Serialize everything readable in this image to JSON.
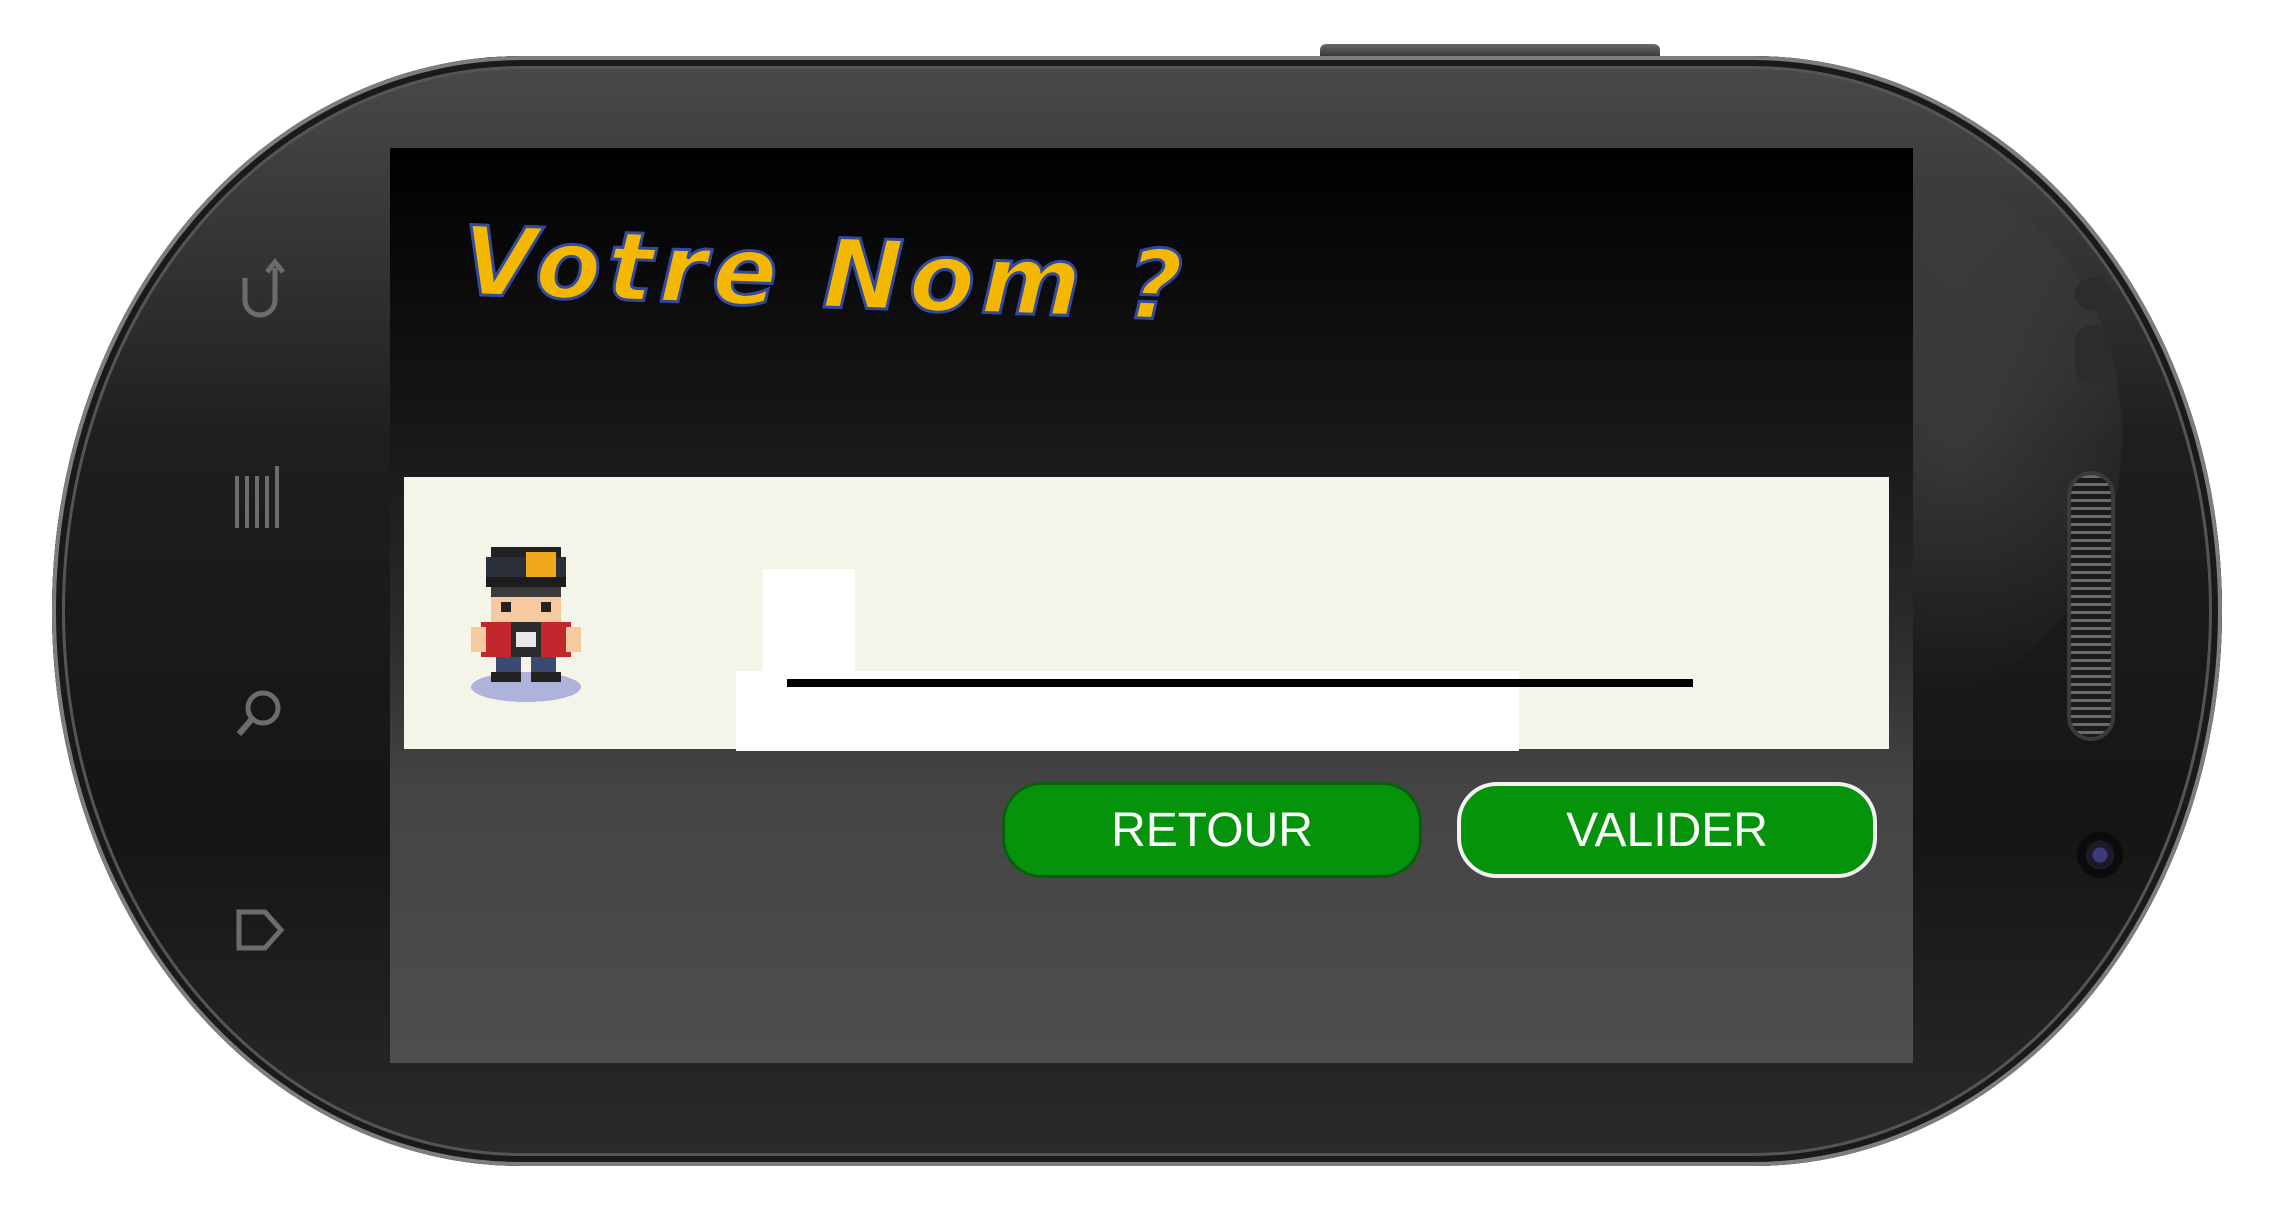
{
  "device": {
    "nav_keys": [
      "back-icon",
      "menu-icon",
      "search-icon",
      "home-icon"
    ]
  },
  "screen": {
    "title": "Votre Nom ?",
    "title_color": "#f5b800",
    "title_outline_color": "#2f4a9e",
    "name_input": {
      "value": "",
      "placeholder": ""
    },
    "avatar": "trainer-sprite",
    "buttons": {
      "back_label": "RETOUR",
      "validate_label": "VALIDER",
      "button_color": "#05930b"
    }
  }
}
